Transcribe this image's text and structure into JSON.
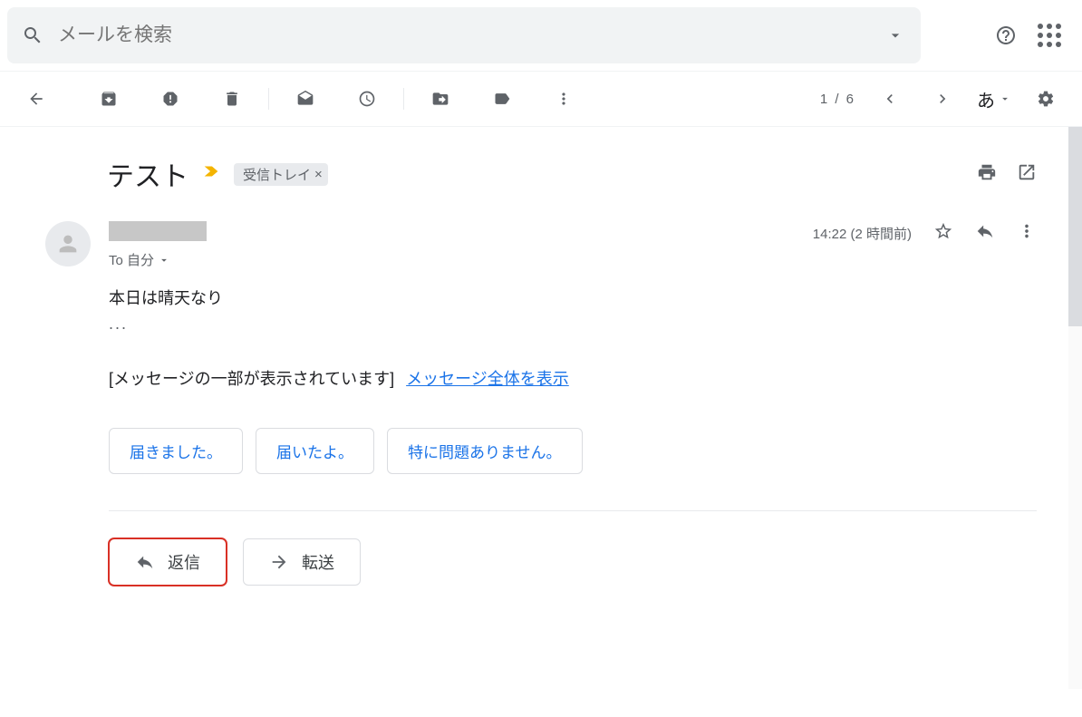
{
  "search": {
    "placeholder": "メールを検索"
  },
  "toolbar": {
    "page_count": "1 / 6",
    "lang": "あ"
  },
  "subject": {
    "text": "テスト",
    "chip": "受信トレイ"
  },
  "sender": {
    "to_label": "To 自分",
    "time": "14:22 (2 時間前)"
  },
  "body": {
    "line1": "本日は晴天なり",
    "dots": "...",
    "partial_label": "[メッセージの一部が表示されています]",
    "partial_link": "メッセージ全体を表示"
  },
  "smart_replies": [
    "届きました。",
    "届いたよ。",
    "特に問題ありません。"
  ],
  "actions": {
    "reply": "返信",
    "forward": "転送"
  }
}
